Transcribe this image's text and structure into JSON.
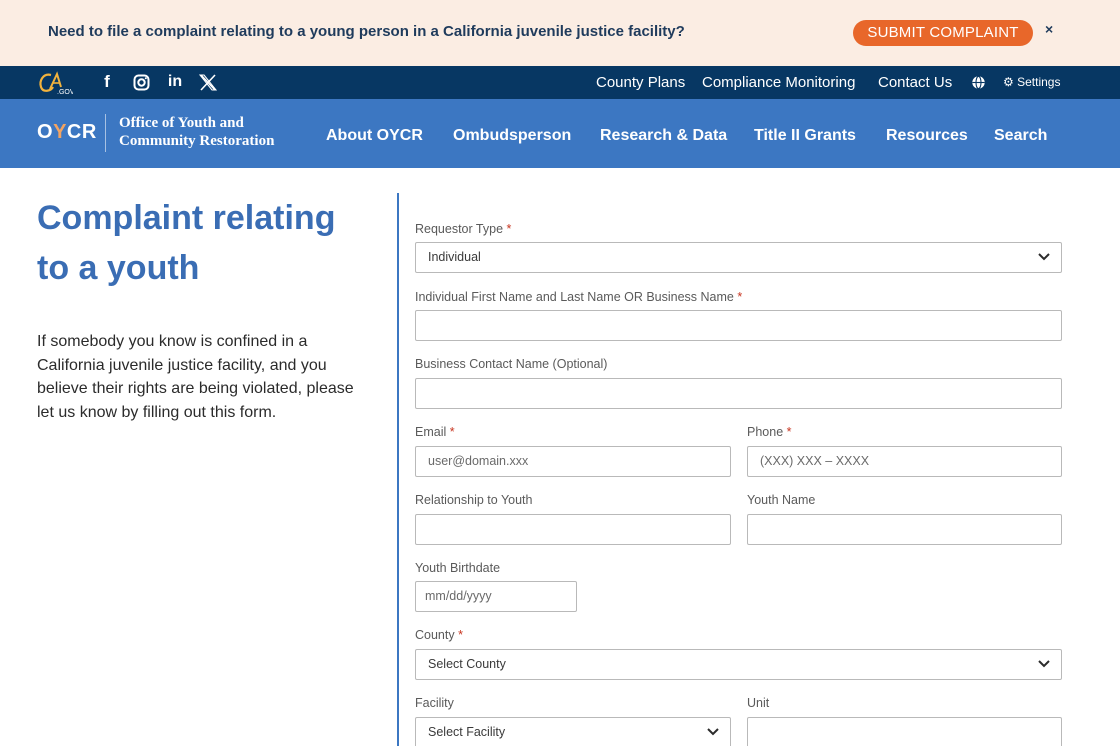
{
  "alert": {
    "text": "Need to file a complaint relating to a young person in a California juvenile justice facility?",
    "button_label": "SUBMIT COMPLAINT",
    "close_glyph": "×"
  },
  "utility_bar": {
    "logo_text": "CA.GOV",
    "social_icons": [
      "facebook-icon",
      "instagram-icon",
      "linkedin-icon",
      "x-icon"
    ],
    "links": [
      "County Plans",
      "Compliance Monitoring",
      "Contact Us"
    ],
    "settings_label": "Settings"
  },
  "nav": {
    "brand_abbr": "OYCR",
    "brand_name_line1": "Office of Youth and",
    "brand_name_line2": "Community Restoration",
    "links": [
      "About OYCR",
      "Ombudsperson",
      "Research & Data",
      "Title II Grants",
      "Resources",
      "Search"
    ]
  },
  "page": {
    "title": "Complaint relating to a youth",
    "intro": "If somebody you know is confined in a California juvenile justice facility, and you believe their rights are being violated, please let us know by filling out this form."
  },
  "form": {
    "requestor_type": {
      "label": "Requestor Type",
      "value": "Individual"
    },
    "name": {
      "label": "Individual First Name and Last Name OR Business Name",
      "value": ""
    },
    "business_contact": {
      "label": "Business Contact Name (Optional)",
      "value": ""
    },
    "email": {
      "label": "Email",
      "placeholder": "user@domain.xxx"
    },
    "phone": {
      "label": "Phone",
      "placeholder": "(XXX) XXX – XXXX"
    },
    "relationship": {
      "label": "Relationship to Youth",
      "value": ""
    },
    "youth_name": {
      "label": "Youth Name",
      "value": ""
    },
    "birthdate": {
      "label": "Youth Birthdate",
      "placeholder": "mm/dd/yyyy"
    },
    "county": {
      "label": "County",
      "value": "Select County"
    },
    "facility": {
      "label": "Facility",
      "value": "Select Facility"
    },
    "unit": {
      "label": "Unit",
      "value": ""
    },
    "required_marker": "*"
  },
  "colors": {
    "alert_bg": "#fbede3",
    "alert_button": "#e8672a",
    "utility_bar": "#073763",
    "nav_bar": "#3c77c2",
    "title": "#3a6db4",
    "required": "#c7341f"
  }
}
